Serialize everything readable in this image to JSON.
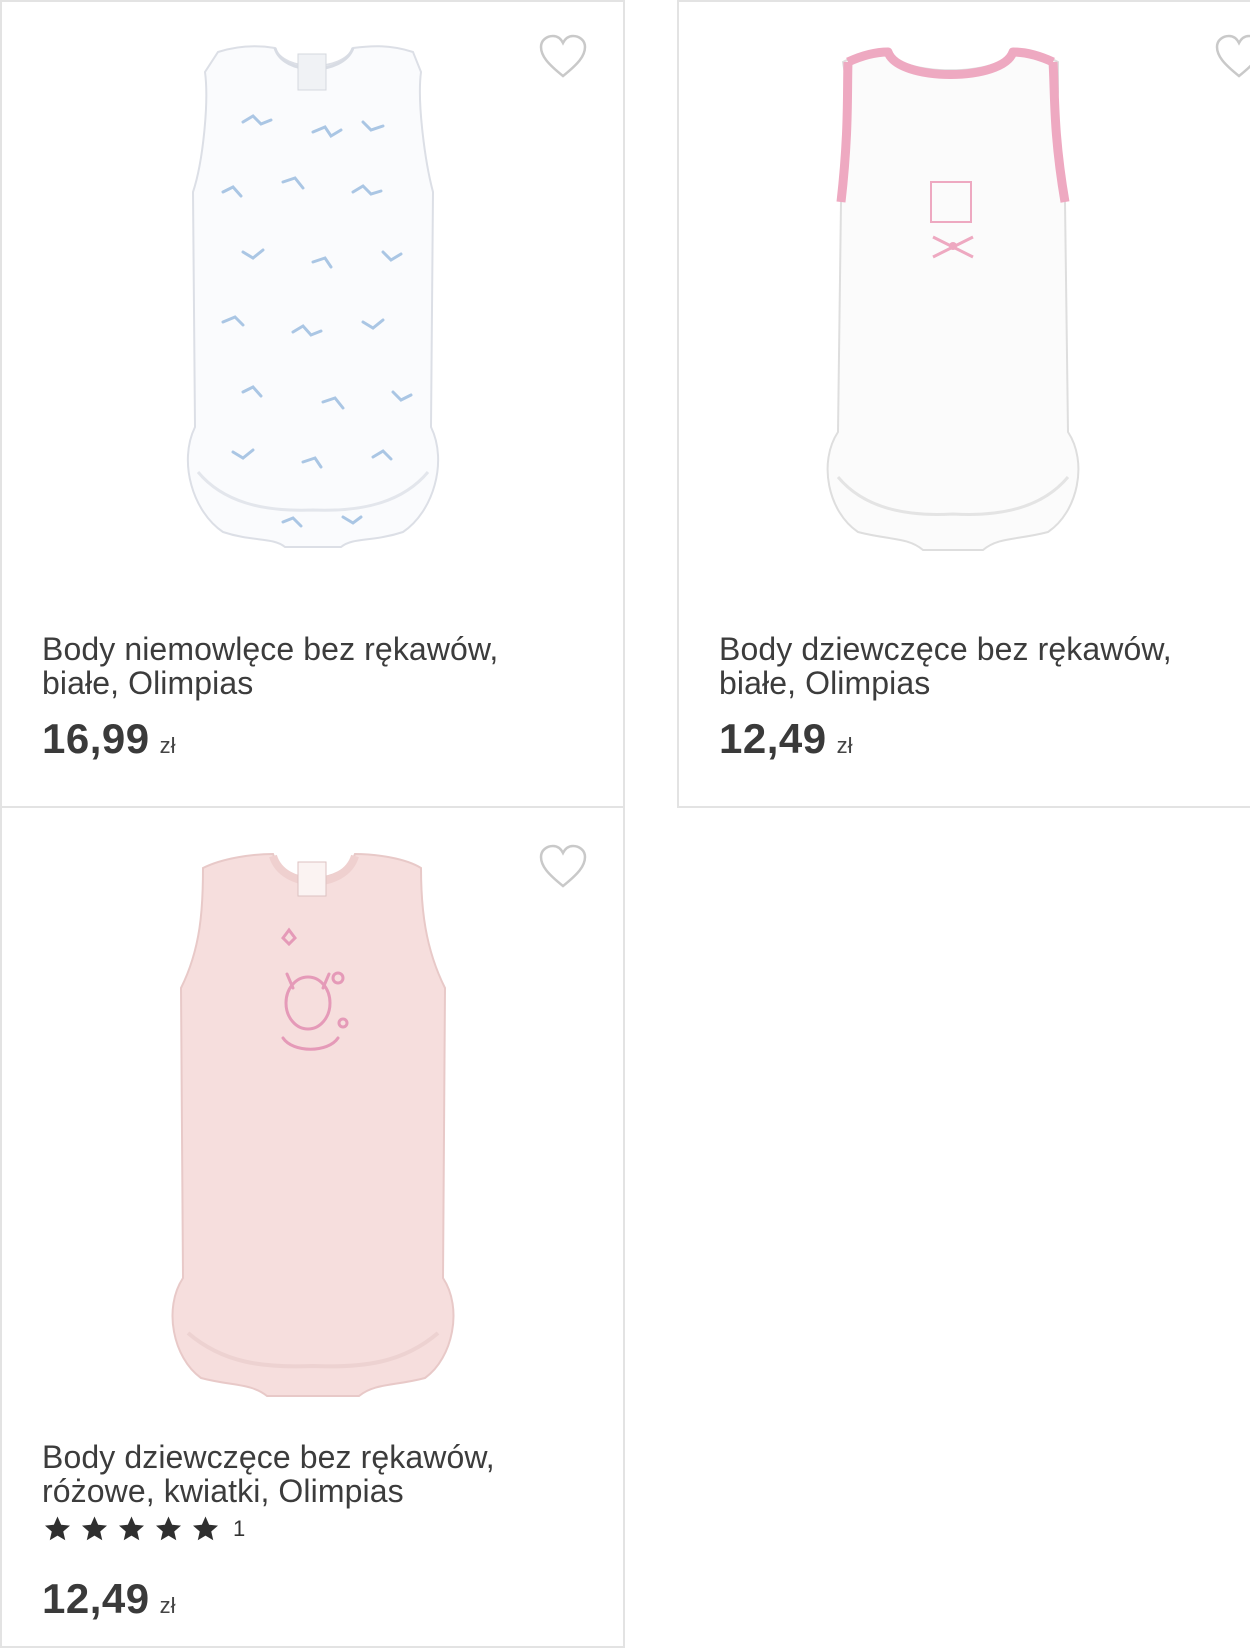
{
  "products": [
    {
      "title_line1": "Body niemowlęce bez rękawów,",
      "title_line2": "białe, Olimpias",
      "price": "16,99",
      "currency": "zł",
      "image": "white-bodysuit-blue-print",
      "favorite_icon": "heart-outline-icon"
    },
    {
      "title_line1": "Body dziewczęce bez rękawów,",
      "title_line2": "białe, Olimpias",
      "price": "12,49",
      "currency": "zł",
      "image": "white-bodysuit-pink-trim",
      "favorite_icon": "heart-outline-icon"
    },
    {
      "title_line1": "Body dziewczęce bez rękawów,",
      "title_line2": "różowe, kwiatki, Olimpias",
      "rating_stars": 5,
      "rating_count": "1",
      "price": "12,49",
      "currency": "zł",
      "image": "pink-bodysuit-flower-print",
      "favorite_icon": "heart-outline-icon"
    }
  ],
  "colors": {
    "border": "#e3e3e3",
    "text": "#3c3c3c",
    "star": "#2f2f2f",
    "heart": "#c9c9c9",
    "pink_trim": "#eea9c1",
    "pink_body": "#f6dedd",
    "blue_print": "#9dbde0"
  }
}
